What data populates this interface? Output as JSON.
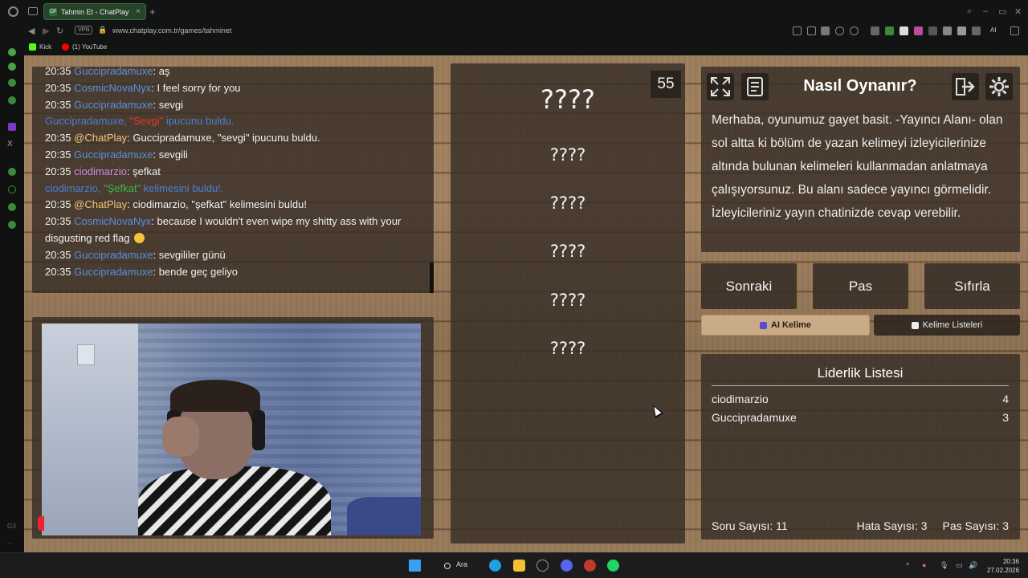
{
  "browser": {
    "tab_title": "Tahmin Et - ChatPlay",
    "tab_favicon": "CP",
    "url": "www.chatplay.com.tr/games/tahminet",
    "vpn_label": "VPN",
    "ai_label": "AI",
    "bookmarks": [
      {
        "label": "Kick",
        "color": "#53fc18"
      },
      {
        "label": "(1) YouTube",
        "color": "#ff0000"
      }
    ]
  },
  "chat": {
    "messages": [
      {
        "time": "20:35",
        "user": "Guccipradamuxe",
        "sep": ": ",
        "text": "aş",
        "user_color": "blue"
      },
      {
        "time": "20:35",
        "user": "CosmicNovaNyx",
        "sep": ": ",
        "text": "I feel sorry for you",
        "user_color": "blue"
      },
      {
        "time": "20:35",
        "user": "Guccipradamuxe",
        "sep": ": ",
        "text": "sevgi",
        "user_color": "blue"
      },
      {
        "system": true,
        "pre": "Guccipradamuxe, ",
        "keyword": "\"Sevgi\"",
        "post": " ipucunu buldu.",
        "kw_color": "red"
      },
      {
        "time": "20:35",
        "user": "@ChatPlay",
        "sep": ": ",
        "text": "Guccipradamuxe, \"sevgi\" ipucunu buldu.",
        "user_color": "gold"
      },
      {
        "time": "20:35",
        "user": "Guccipradamuxe",
        "sep": ": ",
        "text": "sevgili",
        "user_color": "blue"
      },
      {
        "time": "20:35",
        "user": "ciodimarzio",
        "sep": ": ",
        "text": "şefkat",
        "user_color": "pink"
      },
      {
        "system": true,
        "pre": "ciodimarzio, ",
        "keyword": "\"Şefkat\"",
        "post": " kelimesini buldu!.",
        "kw_color": "green"
      },
      {
        "time": "20:35",
        "user": "@ChatPlay",
        "sep": ": ",
        "text": "ciodimarzio, \"şefkat\" kelimesini buldu!",
        "user_color": "gold"
      },
      {
        "time": "20:35",
        "user": "CosmicNovaNyx",
        "sep": ": ",
        "text": "because I wouldn't even wipe my shitty ass with your disgusting red flag",
        "user_color": "blue",
        "emoji": true
      },
      {
        "time": "20:35",
        "user": "Guccipradamuxe",
        "sep": ": ",
        "text": "sevgililer günü",
        "user_color": "blue"
      },
      {
        "time": "20:35",
        "user": "Guccipradamuxe",
        "sep": ": ",
        "text": "bende geç geliyo",
        "user_color": "blue"
      }
    ]
  },
  "game": {
    "timer": "55",
    "main_word": "????",
    "hidden_words": [
      "????",
      "????",
      "????",
      "????",
      "????"
    ]
  },
  "howto": {
    "title": "Nasıl Oynanır?",
    "text": "Merhaba, oyunumuz gayet basit. -Yayıncı Alanı- olan sol altta ki bölüm de yazan kelimeyi izleyicilerinize altında bulunan kelimeleri kullanmadan anlatmaya çalışıyorsunuz. Bu alanı sadece yayıncı görmelidir. İzleyicileriniz yayın chatinizde cevap verebilir."
  },
  "controls": {
    "next": "Sonraki",
    "pass": "Pas",
    "reset": "Sıfırla",
    "tab_ai": "AI Kelime",
    "tab_lists": "Kelime Listeleri"
  },
  "leaderboard": {
    "title": "Liderlik Listesi",
    "rows": [
      {
        "name": "ciodimarzio",
        "score": "4"
      },
      {
        "name": "Guccipradamuxe",
        "score": "3"
      }
    ],
    "question_count": "Soru Sayısı: 11",
    "error_count": "Hata Sayısı: 3",
    "pass_count": "Pas Sayısı: 3"
  },
  "taskbar": {
    "search": "Ara",
    "time": "20:36",
    "date": "27.02.2026"
  },
  "colors": {
    "user_blue": "#5a8fe0",
    "user_pink": "#d68ae8",
    "user_gold": "#f1c778",
    "kw_red": "#e03a2a",
    "kw_green": "#3ab84a",
    "tab_active": "#c9ab85"
  }
}
